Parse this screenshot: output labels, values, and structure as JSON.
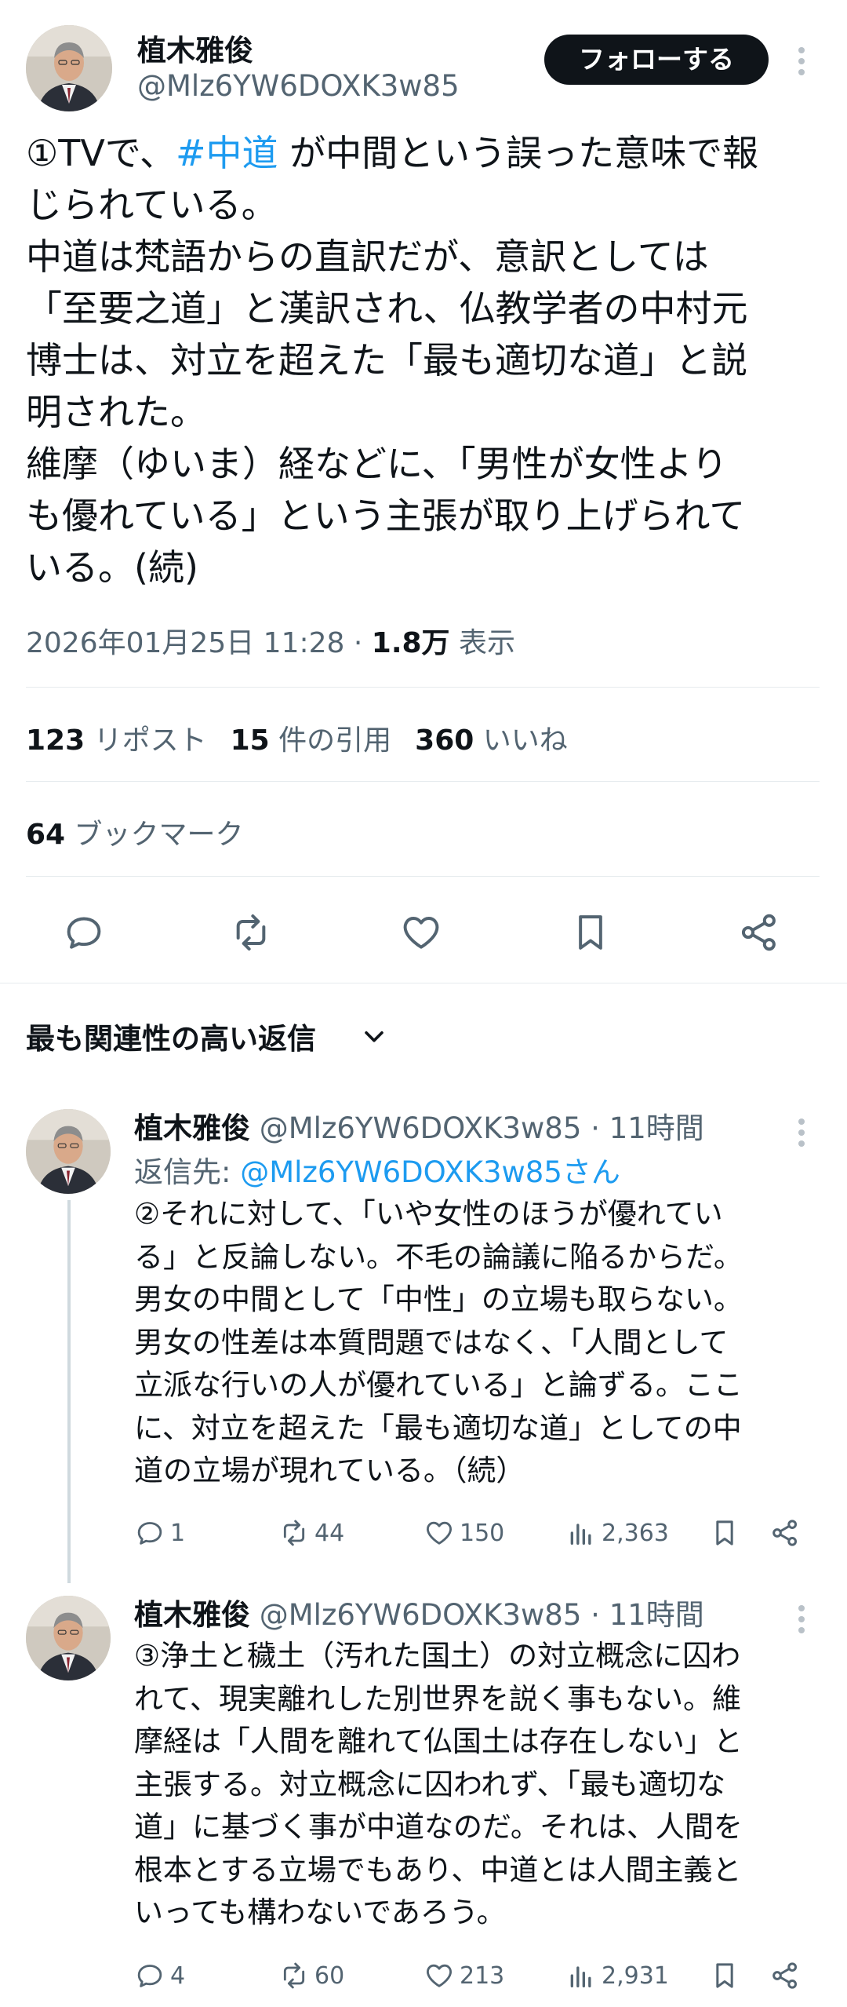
{
  "main_post": {
    "author_name": "植木雅俊",
    "author_handle": "@Mlz6YW6DOXK3w85",
    "follow_label": "フォローする",
    "text_lines": [
      {
        "before": "①TVで、",
        "hashtag": "#中道",
        "after": " が中間という誤った意味で報"
      },
      {
        "before": "じられている。"
      },
      {
        "before": "中道は梵語からの直訳だが、意訳としては"
      },
      {
        "before": "「至要之道」と漢訳され、仏教学者の中村元"
      },
      {
        "before": "博士は、対立を超えた「最も適切な道」と説"
      },
      {
        "before": "明された。"
      },
      {
        "before": "維摩（ゆいま）経などに、「男性が女性より"
      },
      {
        "before": "も優れている」という主張が取り上げられて"
      },
      {
        "before": "いる。(続)"
      }
    ],
    "timestamp": "2026年01月25日 11:28",
    "separator": " · ",
    "views_count": "1.8万",
    "views_label": " 表示",
    "reposts_count": "123",
    "reposts_label": " リポスト",
    "quotes_count": "15",
    "quotes_label": " 件の引用",
    "likes_count": "360",
    "likes_label": " いいね",
    "bookmarks_count": "64",
    "bookmarks_label": " ブックマーク"
  },
  "replies_section": {
    "title": "最も関連性の高い返信"
  },
  "replies": [
    {
      "name": "植木雅俊",
      "handle": " @Mlz6YW6DOXK3w85",
      "time": " · 11時間",
      "reply_to_label": "返信先: ",
      "reply_to_handle": "@Mlz6YW6DOXK3w85さん",
      "text_lines": [
        "②それに対して、「いや女性のほうが優れてい",
        "る」と反論しない。不毛の論議に陥るからだ。",
        "男女の中間として「中性」の立場も取らない。",
        "男女の性差は本質問題ではなく、「人間として",
        "立派な行いの人が優れている」と論ずる。ここ",
        "に、対立を超えた「最も適切な道」としての中",
        "道の立場が現れている。（続）"
      ],
      "reply_count": "1",
      "repost_count": "44",
      "like_count": "150",
      "view_count": "2,363"
    },
    {
      "name": "植木雅俊",
      "handle": " @Mlz6YW6DOXK3w85",
      "time": " · 11時間",
      "text_lines": [
        "③浄土と穢土（汚れた国土）の対立概念に囚わ",
        "れて、現実離れした別世界を説く事もない。維",
        "摩経は「人間を離れて仏国土は存在しない」と",
        "主張する。対立概念に囚われず、「最も適切な",
        "道」に基づく事が中道なのだ。それは、人間を",
        "根本とする立場でもあり、中道とは人間主義と",
        "いっても構わないであろう。"
      ],
      "reply_count": "4",
      "repost_count": "60",
      "like_count": "213",
      "view_count": "2,931"
    }
  ],
  "colors": {
    "text": "#0f1419",
    "secondary": "#536471",
    "link": "#1d9bf0",
    "follow_bg": "#0f1419",
    "divider": "#e6ebee",
    "thread_line": "#cfd9de"
  },
  "icons": [
    "more-dots-icon",
    "reply-icon",
    "repost-icon",
    "like-icon",
    "bookmark-icon",
    "share-icon",
    "views-icon",
    "chevron-down-icon"
  ]
}
